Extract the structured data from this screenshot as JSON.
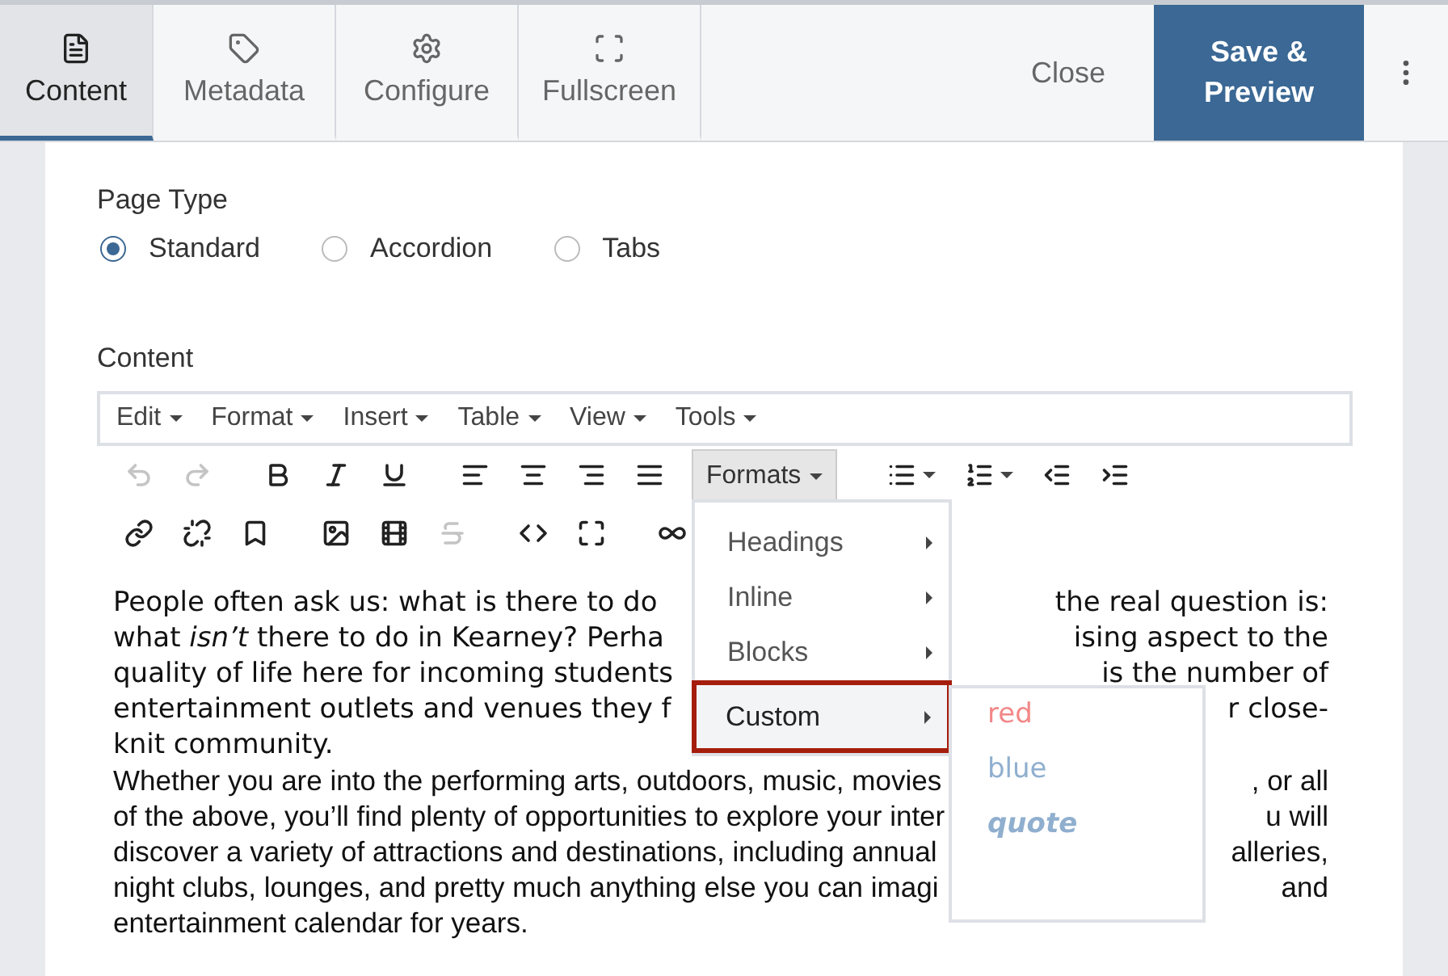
{
  "tabs": [
    {
      "label": "Content",
      "kind": "content",
      "selected": true
    },
    {
      "label": "Metadata",
      "kind": "tag",
      "selected": false
    },
    {
      "label": "Configure",
      "kind": "gear",
      "selected": false
    },
    {
      "label": "Fullscreen",
      "kind": "fullscreen",
      "selected": false
    }
  ],
  "close": "Close",
  "save": "Save & Preview",
  "page_type": {
    "label": "Page Type",
    "options": [
      {
        "label": "Standard",
        "selected": true
      },
      {
        "label": "Accordion",
        "selected": false
      },
      {
        "label": "Tabs",
        "selected": false
      }
    ]
  },
  "editor": {
    "label": "Content",
    "menubar": [
      "Edit",
      "Format",
      "Insert",
      "Table",
      "View",
      "Tools"
    ],
    "toolbar_rows": [
      [
        {
          "kind": "undo",
          "disabled": true
        },
        {
          "kind": "redo",
          "disabled": true
        },
        {
          "kind": "gap"
        },
        {
          "kind": "bold",
          "disabled": false
        },
        {
          "kind": "italic",
          "disabled": false
        },
        {
          "kind": "underline",
          "disabled": false
        },
        {
          "kind": "gap"
        },
        {
          "kind": "align-left",
          "disabled": false
        },
        {
          "kind": "align-center",
          "disabled": false
        },
        {
          "kind": "align-right",
          "disabled": false
        },
        {
          "kind": "align-justify",
          "disabled": false
        },
        {
          "kind": "formats",
          "label": "Formats"
        },
        {
          "kind": "bullets",
          "disabled": false
        },
        {
          "kind": "numbers",
          "disabled": false
        },
        {
          "kind": "outdent",
          "disabled": false
        },
        {
          "kind": "indent",
          "disabled": false
        }
      ],
      [
        {
          "kind": "link",
          "disabled": false
        },
        {
          "kind": "unlink",
          "disabled": false
        },
        {
          "kind": "bookmark",
          "disabled": false
        },
        {
          "kind": "gap"
        },
        {
          "kind": "image",
          "disabled": false
        },
        {
          "kind": "media",
          "disabled": false
        },
        {
          "kind": "strike",
          "disabled": true
        },
        {
          "kind": "gap"
        },
        {
          "kind": "code",
          "disabled": false
        },
        {
          "kind": "fullscreen",
          "disabled": false
        },
        {
          "kind": "gap"
        },
        {
          "kind": "infinity",
          "disabled": false
        }
      ]
    ],
    "format_menu": [
      {
        "label": "Headings",
        "highlighted": false
      },
      {
        "label": "Inline",
        "highlighted": false
      },
      {
        "label": "Blocks",
        "highlighted": false
      },
      {
        "label": "Custom",
        "highlighted": true
      }
    ],
    "custom_submenu": [
      {
        "label": "red",
        "kind": "red"
      },
      {
        "label": "blue",
        "kind": "blue"
      },
      {
        "label": "quote",
        "kind": "quote"
      }
    ],
    "paragraphs": [
      {
        "kind": "lead",
        "lines": [
          {
            "left": "People often ask us: what is there to do",
            "right": "the real question is:"
          },
          {
            "left": "what *isn’t* there to do in Kearney? Perha",
            "right": "ising aspect to the"
          },
          {
            "left": "quality of life here for incoming students",
            "right": "is the number of"
          },
          {
            "left": "entertainment outlets and venues they f",
            "right": "r close-"
          },
          {
            "left": "knit community."
          }
        ]
      },
      {
        "kind": "body",
        "lines": [
          {
            "left": "Whether you are into the performing arts, outdoors, music, movies",
            "right": ", or all"
          },
          {
            "left": "of the above, you’ll find plenty of opportunities to explore your inter",
            "right": "u will"
          },
          {
            "left": "discover a variety of attractions and destinations, including annual",
            "right": "alleries,"
          },
          {
            "left": "night clubs, lounges, and pretty much anything else you can imagi",
            "right": "and"
          },
          {
            "left": "entertainment calendar for years."
          }
        ]
      }
    ]
  }
}
